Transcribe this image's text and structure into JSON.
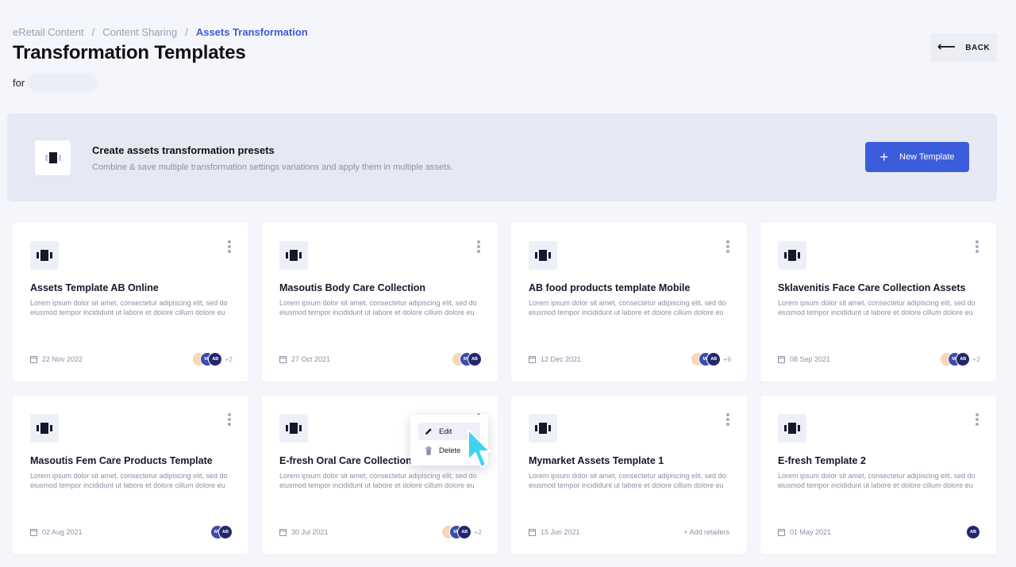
{
  "breadcrumb": {
    "items": [
      "eRetail Content",
      "Content Sharing",
      "Assets Transformation"
    ],
    "separator": "/"
  },
  "page": {
    "title": "Transformation Templates",
    "for_label": "for"
  },
  "back_button": {
    "label": "BACK",
    "icon": "arrow-left-icon"
  },
  "banner": {
    "title": "Create assets transformation presets",
    "subtitle": "Combine & save multiple transformation settings variations and apply them in multiple assets.",
    "button_label": "New Template",
    "button_icon": "plus-icon"
  },
  "colors": {
    "accent": "#3b5ddb",
    "breadcrumb_current": "#3d5bd9",
    "avatar_peach": "#f8d6b8",
    "avatar_blue": "#3e4cae",
    "avatar_navy": "#23286e"
  },
  "cards": [
    {
      "title": "Assets Template AB Online",
      "desc": "Lorem ipsum dolor sit amet, consectetur adipiscing elit, sed do eiusmod tempor incididunt ut labore et  dolore cillum dolore eu",
      "date": "22 Nov 2022",
      "avatars": [
        "",
        "MT",
        "AB"
      ],
      "extra": "+2"
    },
    {
      "title": "Masoutis Body Care Collection",
      "desc": "Lorem ipsum dolor sit amet, consectetur adipiscing elit, sed do eiusmod tempor incididunt ut labore et  dolore cillum dolore eu",
      "date": "27 Oct 2021",
      "avatars": [
        "",
        "MT",
        "AB"
      ],
      "extra": ""
    },
    {
      "title": "AB food products template Mobile",
      "desc": "Lorem ipsum dolor sit amet, consectetur adipiscing elit, sed do eiusmod tempor incididunt ut labore et  dolore cillum dolore eu",
      "date": "12 Dec 2021",
      "avatars": [
        "",
        "MT",
        "AB"
      ],
      "extra": "+9"
    },
    {
      "title": "Sklavenitis Face Care Collection Assets",
      "desc": "Lorem ipsum dolor sit amet, consectetur adipiscing elit, sed do eiusmod tempor incididunt ut labore et  dolore cillum dolore eu",
      "date": "08 Sep 2021",
      "avatars": [
        "",
        "MT",
        "AB"
      ],
      "extra": "+2"
    },
    {
      "title": "Masoutis Fem Care Products Template",
      "desc": "Lorem ipsum dolor sit amet, consectetur adipiscing elit, sed do eiusmod tempor incididunt ut labore et  dolore cillum dolore eu",
      "date": "02 Aug 2021",
      "avatars": [
        "MT",
        "AB"
      ],
      "extra": ""
    },
    {
      "title": "E-fresh Oral Care Collection",
      "desc": "Lorem ipsum dolor sit amet, consectetur adipiscing elit, sed do eiusmod tempor incididunt ut labore et  dolore cillum dolore eu",
      "date": "30 Jul 2021",
      "avatars": [
        "",
        "MT",
        "AB"
      ],
      "extra": "+2"
    },
    {
      "title": "Mymarket Assets Template 1",
      "desc": "Lorem ipsum dolor sit amet, consectetur adipiscing elit, sed do eiusmod tempor incididunt ut labore et  dolore cillum dolore eu",
      "date": "15 Jun 2021",
      "avatars": [],
      "extra": "",
      "add_retailers": "+ Add retailers"
    },
    {
      "title": "E-fresh Template 2",
      "desc": "Lorem ipsum dolor sit amet, consectetur adipiscing elit, sed do eiusmod tempor incididunt ut labore et  dolore cillum dolore eu",
      "date": "01 May 2021",
      "avatars": [
        "AB"
      ],
      "extra": ""
    }
  ],
  "context_menu": {
    "items": [
      {
        "label": "Edit",
        "icon": "pencil-icon"
      },
      {
        "label": "Delete",
        "icon": "trash-icon"
      }
    ]
  }
}
